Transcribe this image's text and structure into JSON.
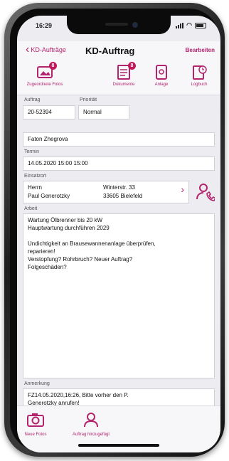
{
  "status": {
    "time": "16:29"
  },
  "nav": {
    "back_label": "KD-Aufträge",
    "title": "KD-Auftrag",
    "edit_label": "Bearbeiten"
  },
  "toolbar": {
    "items": [
      {
        "label": "Zugeordnete Fotos",
        "badge": "8",
        "icon": "photo-icon"
      },
      {
        "label": "Dokumente",
        "badge": "8",
        "icon": "document-icon"
      },
      {
        "label": "Anlage",
        "icon": "device-icon"
      },
      {
        "label": "Logbuch",
        "icon": "logbook-icon"
      }
    ]
  },
  "form": {
    "auftrag_label": "Auftrag",
    "auftrag_value": "20-52394",
    "prioritaet_label": "Priorität",
    "prioritaet_value": "Normal",
    "bearbeiter_value": "Faton Zhegrova",
    "termin_label": "Termin",
    "termin_value": "14.05.2020 15:00 15:00",
    "einsatzort_label": "Einsatzort",
    "einsatzort": {
      "salutation": "Herrn",
      "name": "Paul Generotzky",
      "street": "Winterstr. 33",
      "city": "33605 Bielefeld"
    },
    "arbeit_label": "Arbeit",
    "arbeit_lines": [
      "Wartung Ölbrenner bis 20 kW",
      "Hauptwartung durchführen 2029",
      "",
      "Undichtigkeit an Brausewannenanlage überprüfen,",
      "reparieren!",
      "Verstopfung? Rohrbruch? Neuer Auftrag?",
      "Folgeschäden?"
    ],
    "anmerkung_label": "Anmerkung",
    "anmerkung_lines": [
      "FZ14.05.2020,16:26, Bitte vorher den P.",
      "Generotzky anrufen!"
    ]
  },
  "bottom": {
    "new_photos_label": "Neue Fotos",
    "assign_label": "Auftrag hinzugefügt"
  },
  "colors": {
    "accent": "#b3246f",
    "badge": "#c2185b",
    "background": "#ededf1"
  }
}
